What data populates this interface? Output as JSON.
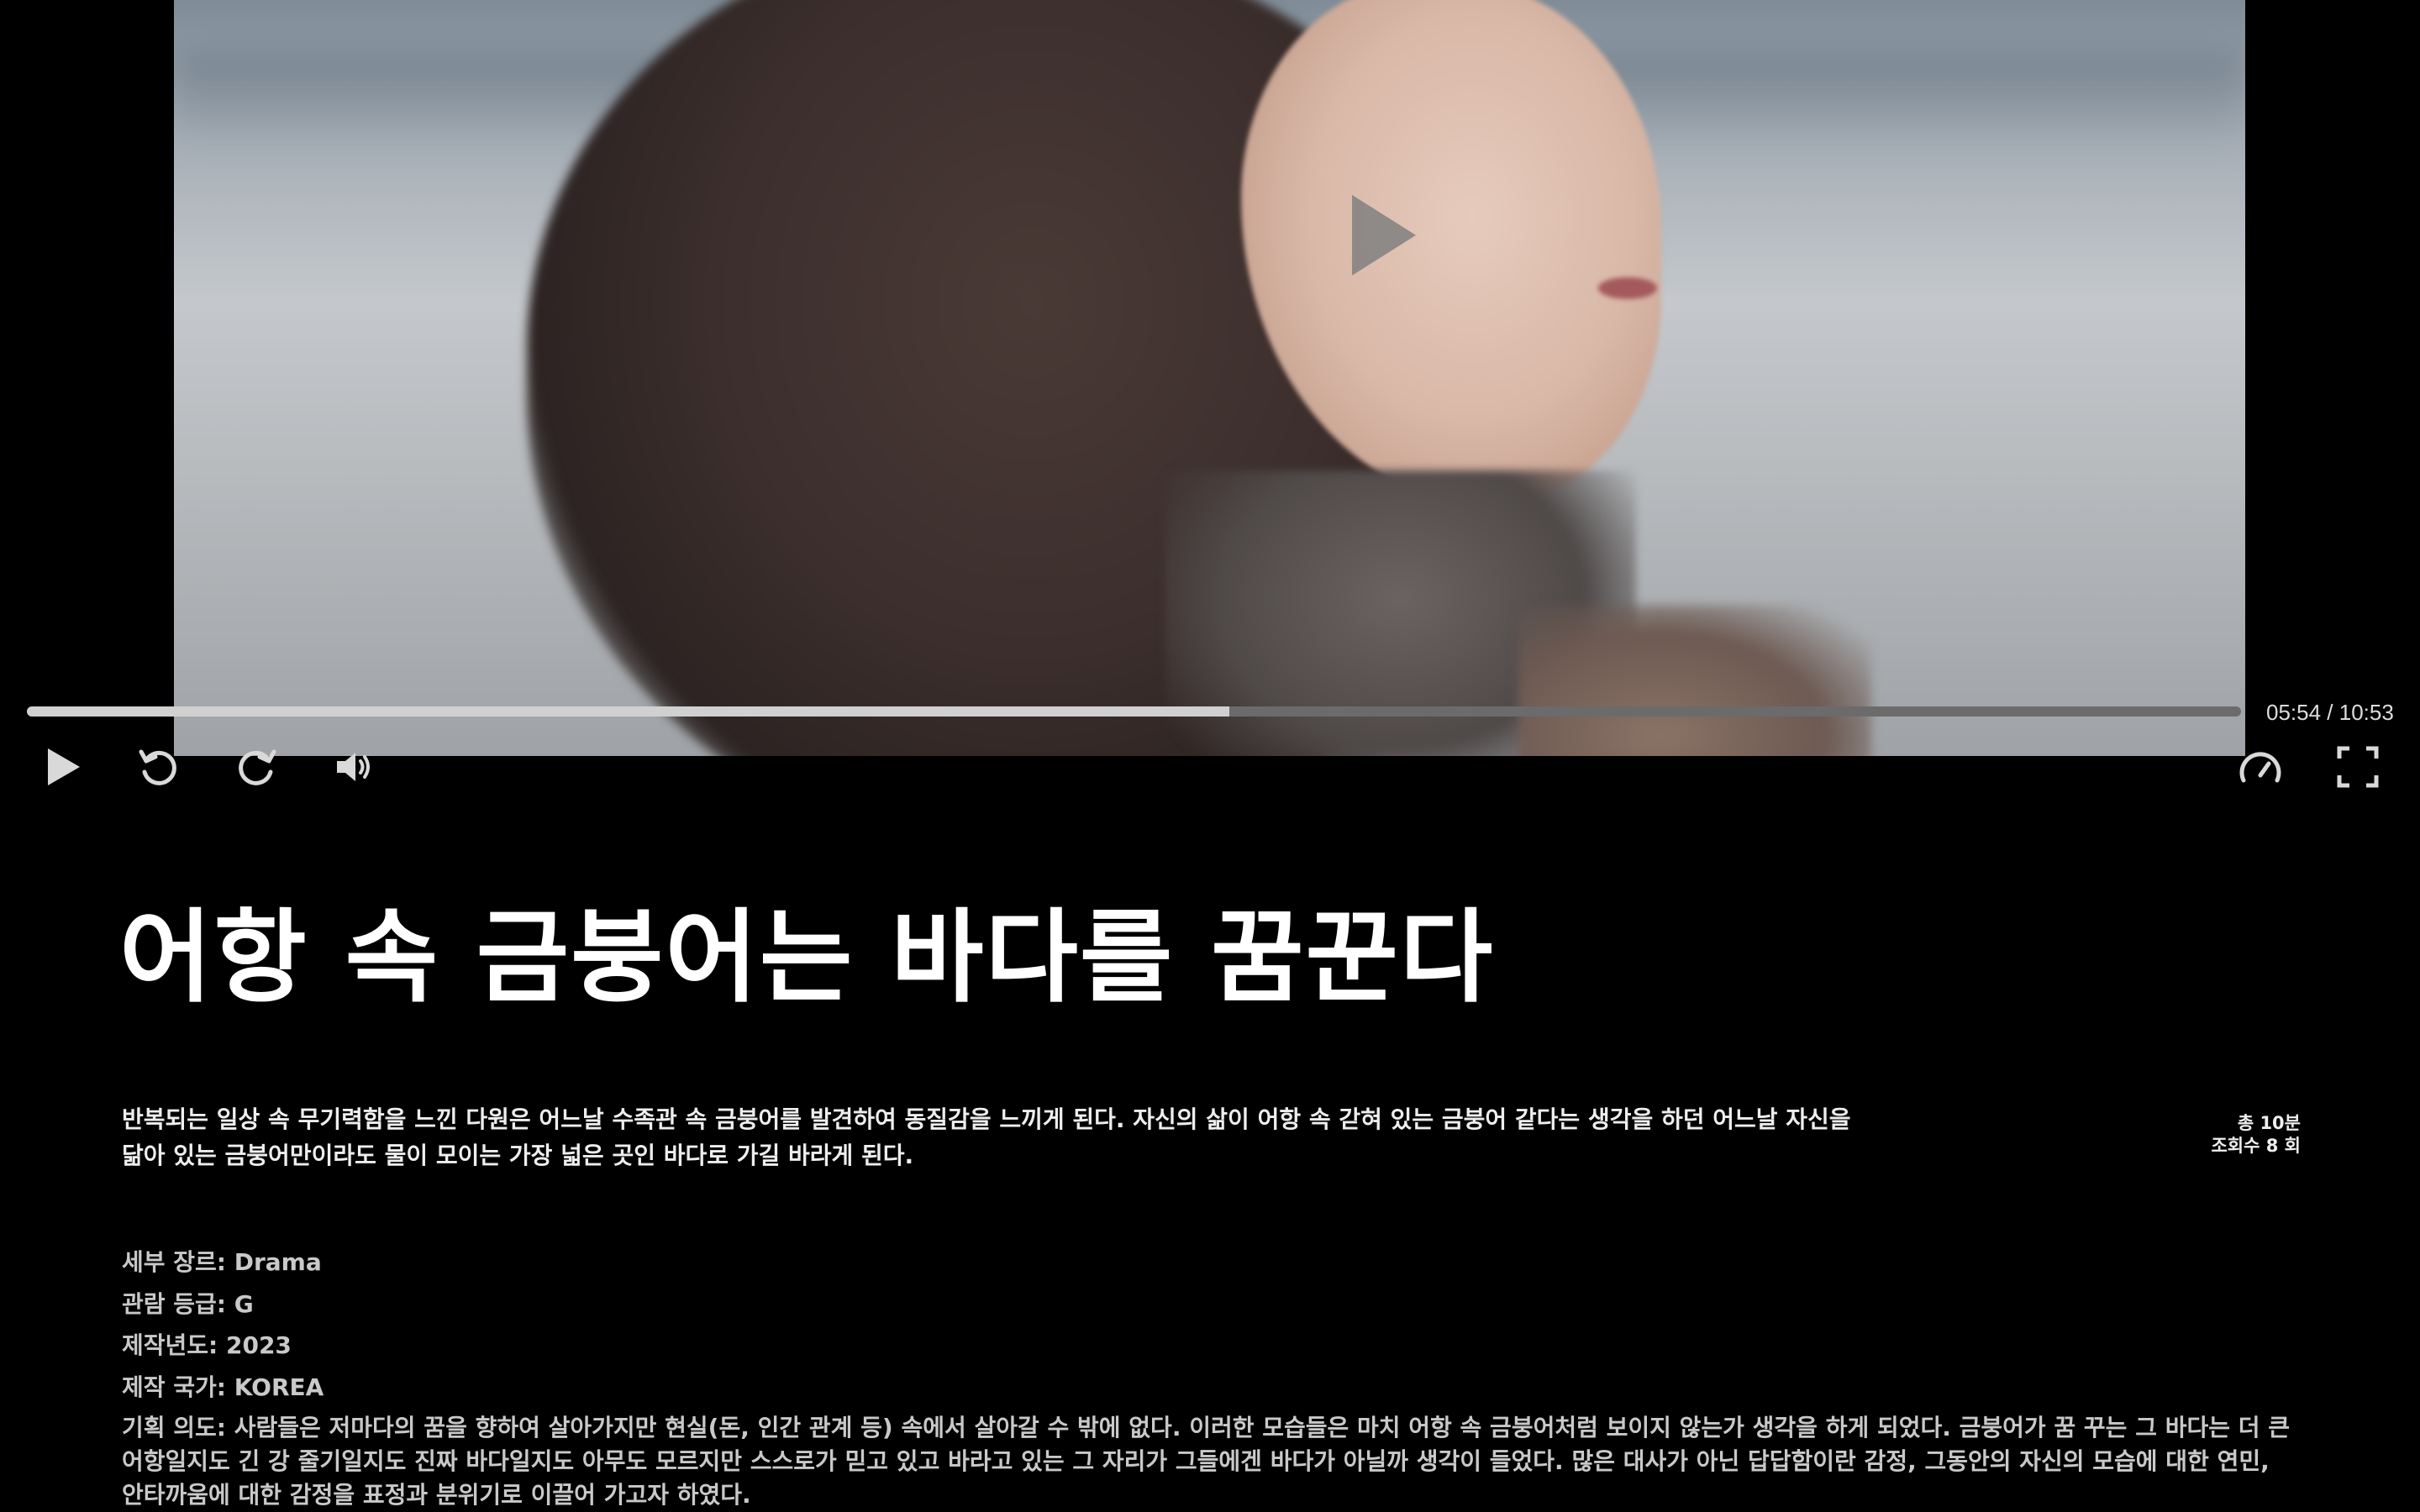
{
  "player": {
    "current_time": "05:54",
    "total_time": "10:53",
    "time_display": "05:54 / 10:53",
    "progress_fraction": 0.543,
    "icons": {
      "center_play": "play-icon",
      "play": "play-icon",
      "rewind": "rewind-icon",
      "forward": "forward-icon",
      "volume": "volume-icon",
      "speed": "speedometer-icon",
      "fullscreen": "fullscreen-icon"
    }
  },
  "movie": {
    "title": "어항 속 금붕어는 바다를 꿈꾼다",
    "synopsis": "반복되는 일상 속 무기력함을 느낀 다원은 어느날 수족관 속 금붕어를 발견하여 동질감을 느끼게 된다. 자신의 삶이 어항 속 갇혀 있는 금붕어 같다는 생각을 하던 어느날 자신을 닮아 있는 금붕어만이라도 물이 모이는 가장 넓은 곳인 바다로 가길 바라게 된다.",
    "duration": "총 10분",
    "views": "조회수 8 회",
    "details": {
      "genre": "세부 장르: Drama",
      "rating": "관람 등급: G",
      "year": "제작년도: 2023",
      "country": "제작 국가: KOREA",
      "intent": "기획 의도: 사람들은 저마다의 꿈을 향하여 살아가지만 현실(돈, 인간 관계 등) 속에서 살아갈 수 밖에 없다. 이러한 모습들은 마치 어항 속 금붕어처럼 보이지 않는가 생각을 하게 되었다. 금붕어가 꿈 꾸는 그 바다는 더 큰 어항일지도 긴 강 줄기일지도 진짜 바다일지도 아무도 모르지만 스스로가 믿고 있고 바라고 있는 그 자리가 그들에겐 바다가 아닐까 생각이 들었다. 많은 대사가 아닌 답답함이란 감정, 그동안의 자신의 모습에 대한 연민, 안타까움에 대한 감정을 표정과 분위기로 이끌어 가고자 하였다."
    }
  },
  "colors": {
    "background": "#000000",
    "progress_fill": "#d0d0d0",
    "progress_track": "#6b6b6b",
    "detail_text": "#c9c9c9"
  }
}
